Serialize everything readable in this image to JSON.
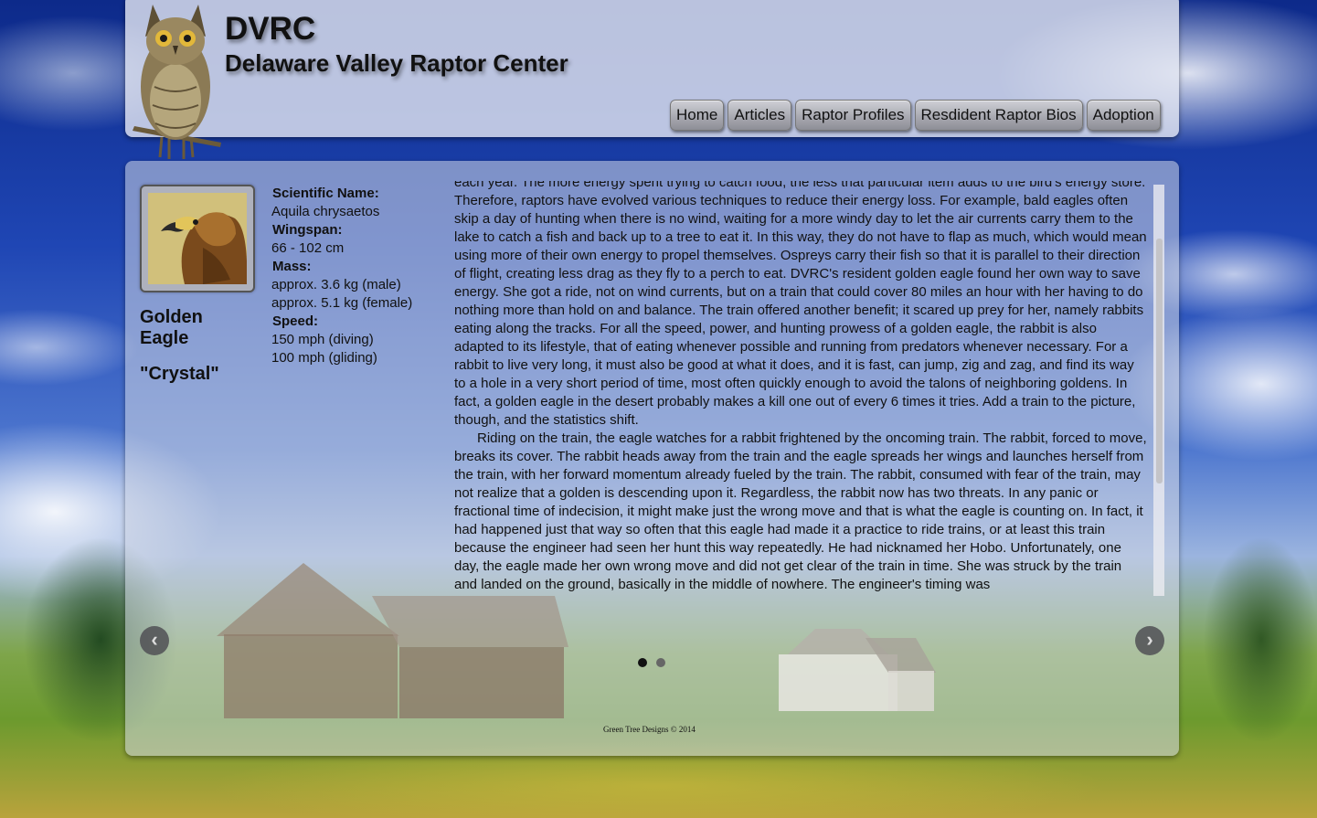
{
  "header": {
    "abbr": "DVRC",
    "name": "Delaware Valley Raptor Center"
  },
  "nav": {
    "items": [
      "Home",
      "Articles",
      "Raptor Profiles",
      "Resdident Raptor Bios",
      "Adoption"
    ]
  },
  "profile": {
    "common_name": "Golden Eagle",
    "nickname": "\"Crystal\"",
    "facts": [
      {
        "label": "Scientific Name:",
        "values": [
          "Aquila chrysaetos"
        ]
      },
      {
        "label": "Wingspan:",
        "values": [
          "66 - 102 cm"
        ]
      },
      {
        "label": "Mass:",
        "values": [
          "approx. 3.6 kg (male)",
          "approx. 5.1 kg (female)"
        ]
      },
      {
        "label": "Speed:",
        "values": [
          "150 mph (diving)",
          "100 mph (gliding)"
        ]
      }
    ]
  },
  "article": {
    "paragraphs": [
      "each year. The more energy spent trying to catch food, the less that particular item adds to the bird's energy store. Therefore, raptors have evolved various techniques to reduce their energy loss. For example, bald eagles often skip a day of hunting when there is no wind, waiting for a more windy day to let the air currents carry them to the lake to catch a fish and back up to a tree to eat it. In this way, they do not have to flap as much, which would mean using more of their own energy to propel themselves. Ospreys carry their fish so that it is parallel to their direction of flight, creating less drag as they fly to a perch to eat. DVRC's resident golden eagle found her own way to save energy. She got a ride, not on wind currents, but on a train that could cover 80 miles an hour with her having to do nothing more than hold on and balance. The train offered another benefit; it scared up prey for her, namely rabbits eating along the tracks. For all the speed, power, and hunting prowess of a golden eagle, the rabbit is also adapted to its lifestyle, that of eating whenever possible and running from predators whenever necessary. For a rabbit to live very long, it must also be good at what it does, and it is fast, can jump, zig and zag, and find its way to a hole in a very short period of time, most often quickly enough to avoid the talons of neighboring goldens. In fact, a golden eagle in the desert probably makes a kill one out of every 6 times it tries. Add a train to the picture, though, and the statistics shift.",
      "Riding on the train, the eagle watches for a rabbit frightened by the oncoming train. The rabbit, forced to move, breaks its cover. The rabbit heads away from the train and the eagle spreads her wings and launches herself from the train, with her forward momentum already fueled by the train. The rabbit, consumed with fear of the train, may not realize that a golden is descending upon it. Regardless, the rabbit now has two threats. In any panic or fractional time of indecision, it might make just the wrong move and that is what the eagle is counting on. In fact, it had happened just that way so often that this eagle had made it a practice to ride trains, or at least this train because the engineer had seen her hunt this way repeatedly. He had nicknamed her Hobo. Unfortunately, one day, the eagle made her own wrong move and did not get clear of the train in time. She was struck by the train and landed on the ground, basically in the middle of nowhere. The engineer's timing was"
    ]
  },
  "carousel": {
    "prev_label": "‹",
    "next_label": "›",
    "active_index": 0,
    "slide_count": 2
  },
  "footer": {
    "text": "Green Tree Designs © 2014"
  }
}
